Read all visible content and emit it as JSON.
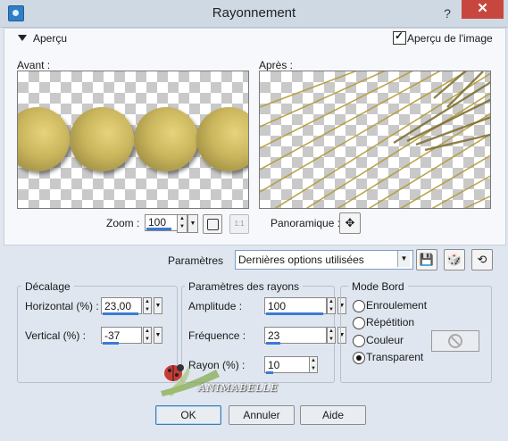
{
  "window": {
    "title": "Rayonnement",
    "help_label": "?",
    "close_label": "✕"
  },
  "preview": {
    "section_label": "Aperçu",
    "image_preview_label": "Aperçu de l'image",
    "image_preview_checked": true,
    "before_label": "Avant :",
    "after_label": "Après :",
    "zoom_label": "Zoom :",
    "zoom_value": "100",
    "zoom_1to1_label": "1:1",
    "pan_label": "Panoramique :",
    "pan_icon": "✥"
  },
  "presets": {
    "label": "Paramètres",
    "selected": "Dernières options utilisées",
    "arrow": "▼"
  },
  "offset": {
    "title": "Décalage",
    "horizontal_label": "Horizontal (%) :",
    "horizontal_value": "23,00",
    "vertical_label": "Vertical (%) :",
    "vertical_value": "-37"
  },
  "rays": {
    "title": "Paramètres des rayons",
    "amplitude_label": "Amplitude :",
    "amplitude_value": "100",
    "frequency_label": "Fréquence :",
    "frequency_value": "23",
    "radius_label": "Rayon (%) :",
    "radius_value": "10"
  },
  "edge_mode": {
    "title": "Mode Bord",
    "options": [
      "Enroulement",
      "Répétition",
      "Couleur",
      "Transparent"
    ],
    "selected": "Transparent"
  },
  "watermark": {
    "text": "ANIMABELLE"
  },
  "buttons": {
    "ok": "OK",
    "cancel": "Annuler",
    "help": "Aide"
  },
  "spin_arrows": {
    "up": "▲",
    "down": "▼"
  },
  "colors": {
    "accent": "#3a7bd5",
    "close": "#c7473e",
    "gold": "#c9b55c"
  }
}
